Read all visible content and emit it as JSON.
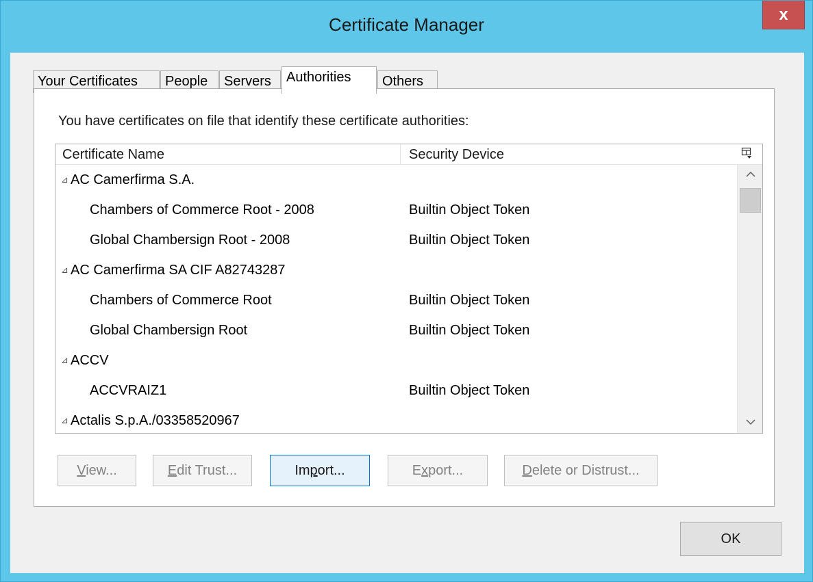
{
  "window": {
    "title": "Certificate Manager",
    "close_label": "x"
  },
  "tabs": [
    {
      "label": "Your Certificates",
      "active": false
    },
    {
      "label": "People",
      "active": false
    },
    {
      "label": "Servers",
      "active": false
    },
    {
      "label": "Authorities",
      "active": true
    },
    {
      "label": "Others",
      "active": false
    }
  ],
  "panel": {
    "description": "You have certificates on file that identify these certificate authorities:"
  },
  "tree": {
    "columns": [
      "Certificate Name",
      "Security Device"
    ],
    "column_picker_icon": "column-picker-icon",
    "rows": [
      {
        "type": "group",
        "twisty": "⊿",
        "name": "AC Camerfirma S.A.",
        "device": ""
      },
      {
        "type": "item",
        "name": "Chambers of Commerce Root - 2008",
        "device": "Builtin Object Token"
      },
      {
        "type": "item",
        "name": "Global Chambersign Root - 2008",
        "device": "Builtin Object Token"
      },
      {
        "type": "group",
        "twisty": "⊿",
        "name": "AC Camerfirma SA CIF A82743287",
        "device": ""
      },
      {
        "type": "item",
        "name": "Chambers of Commerce Root",
        "device": "Builtin Object Token"
      },
      {
        "type": "item",
        "name": "Global Chambersign Root",
        "device": "Builtin Object Token"
      },
      {
        "type": "group",
        "twisty": "⊿",
        "name": "ACCV",
        "device": ""
      },
      {
        "type": "item",
        "name": "ACCVRAIZ1",
        "device": "Builtin Object Token"
      },
      {
        "type": "group",
        "twisty": "⊿",
        "name": "Actalis S.p.A./03358520967",
        "device": ""
      }
    ]
  },
  "buttons": {
    "view": {
      "pre": "",
      "key": "V",
      "post": "iew...",
      "enabled": false
    },
    "edit_trust": {
      "pre": "",
      "key": "E",
      "post": "dit Trust...",
      "enabled": false
    },
    "import": {
      "pre": "Im",
      "key": "p",
      "post": "ort...",
      "enabled": true
    },
    "export": {
      "pre": "E",
      "key": "x",
      "post": "port...",
      "enabled": false
    },
    "delete": {
      "pre": "",
      "key": "D",
      "post": "elete or Distrust...",
      "enabled": false
    },
    "ok": "OK"
  }
}
